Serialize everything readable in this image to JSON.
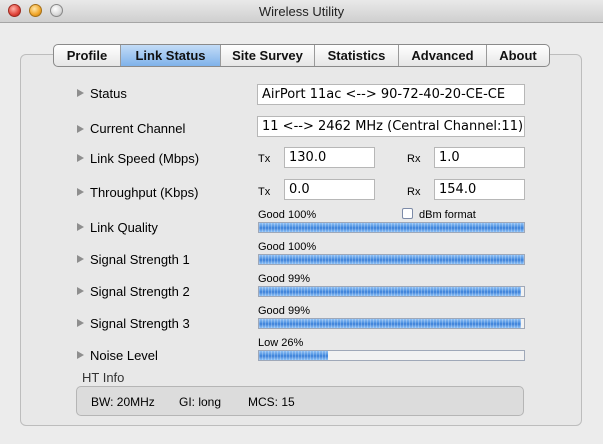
{
  "window": {
    "title": "Wireless Utility"
  },
  "tabs": [
    {
      "label": "Profile",
      "active": false
    },
    {
      "label": "Link Status",
      "active": true
    },
    {
      "label": "Site Survey",
      "active": false
    },
    {
      "label": "Statistics",
      "active": false
    },
    {
      "label": "Advanced",
      "active": false
    },
    {
      "label": "About",
      "active": false
    }
  ],
  "status": {
    "label": "Status",
    "value": "AirPort 11ac <--> 90-72-40-20-CE-CE"
  },
  "channel": {
    "label": "Current Channel",
    "value": "11 <--> 2462 MHz (Central Channel:11)"
  },
  "link_speed": {
    "label": "Link Speed  (Mbps)",
    "tx_label": "Tx",
    "tx": "130.0",
    "rx_label": "Rx",
    "rx": "1.0"
  },
  "throughput": {
    "label": "Throughput (Kbps)",
    "tx_label": "Tx",
    "tx": "0.0",
    "rx_label": "Rx",
    "rx": "154.0"
  },
  "link_quality": {
    "label": "Link Quality",
    "text": "Good 100%",
    "percent": 100
  },
  "dbm": {
    "label": "dBm format",
    "checked": false
  },
  "signal1": {
    "label": "Signal Strength 1",
    "text": "Good 100%",
    "percent": 100
  },
  "signal2": {
    "label": "Signal Strength 2",
    "text": "Good 99%",
    "percent": 99
  },
  "signal3": {
    "label": "Signal Strength 3",
    "text": "Good 99%",
    "percent": 99
  },
  "noise": {
    "label": "Noise Level",
    "text": "Low 26%",
    "percent": 26
  },
  "ht_info": {
    "title": "HT Info",
    "bw": "BW: 20MHz",
    "gi": "GI: long",
    "mcs": "MCS: 15"
  },
  "colors": {
    "tab_active": "#7fb2ea",
    "bar_fill": "#4b8fe0"
  },
  "icons": [
    "close-icon",
    "minimize-icon",
    "zoom-icon",
    "disclosure-arrow-icon"
  ]
}
